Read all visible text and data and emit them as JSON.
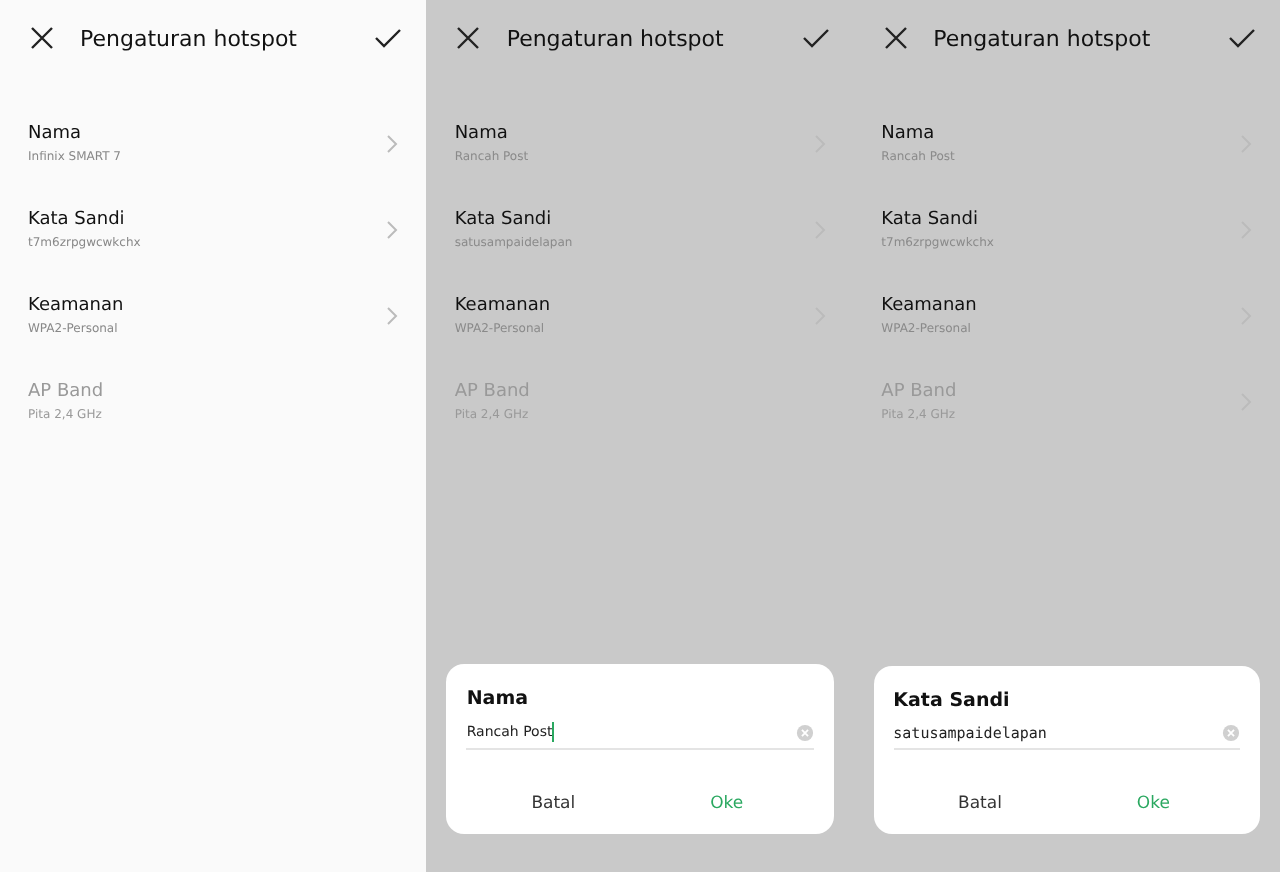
{
  "panels": [
    {
      "dimmed": false,
      "title": "Pengaturan hotspot",
      "items": [
        {
          "label": "Nama",
          "value": "Infinix SMART 7",
          "disabled": false,
          "chevron": true
        },
        {
          "label": "Kata Sandi",
          "value": "t7m6zrpgwcwkchx",
          "disabled": false,
          "chevron": true
        },
        {
          "label": "Keamanan",
          "value": "WPA2-Personal",
          "disabled": false,
          "chevron": true
        },
        {
          "label": "AP Band",
          "value": "Pita 2,4 GHz",
          "disabled": true,
          "chevron": false
        }
      ]
    },
    {
      "dimmed": true,
      "title": "Pengaturan hotspot",
      "items": [
        {
          "label": "Nama",
          "value": "Rancah Post",
          "disabled": false,
          "chevron": true
        },
        {
          "label": "Kata Sandi",
          "value": "satusampaidelapan",
          "disabled": false,
          "chevron": true
        },
        {
          "label": "Keamanan",
          "value": "WPA2-Personal",
          "disabled": false,
          "chevron": true
        },
        {
          "label": "AP Band",
          "value": "Pita 2,4 GHz",
          "disabled": true,
          "chevron": false
        }
      ],
      "dialog": {
        "title": "Nama",
        "value": "Rancah Post",
        "kind": "text",
        "cursor": true,
        "cancel": "Batal",
        "ok": "Oke"
      }
    },
    {
      "dimmed": true,
      "title": "Pengaturan hotspot",
      "items": [
        {
          "label": "Nama",
          "value": "Rancah Post",
          "disabled": false,
          "chevron": true
        },
        {
          "label": "Kata Sandi",
          "value": "t7m6zrpgwcwkchx",
          "disabled": false,
          "chevron": true
        },
        {
          "label": "Keamanan",
          "value": "WPA2-Personal",
          "disabled": false,
          "chevron": true
        },
        {
          "label": "AP Band",
          "value": "Pita 2,4 GHz",
          "disabled": true,
          "chevron": true
        }
      ],
      "dialog": {
        "title": "Kata Sandi",
        "value": "satusampaidelapan",
        "kind": "password",
        "cursor": false,
        "cancel": "Batal",
        "ok": "Oke"
      }
    }
  ]
}
